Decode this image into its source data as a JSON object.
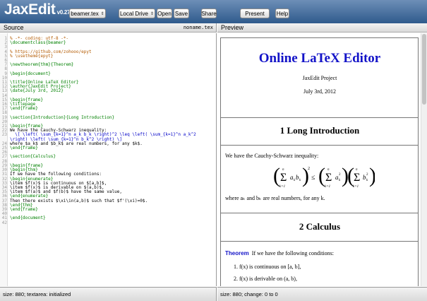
{
  "toolbar": {
    "logo": "JaxEdit",
    "version": "v0.27b",
    "file_select": "beamer.tex",
    "storage_select": "Local Drive",
    "open_label": "Open",
    "save_label": "Save",
    "share_label": "Share",
    "present_label": "Present",
    "help_label": "Help"
  },
  "source": {
    "title": "Source",
    "filename": "noname.tex",
    "lines": [
      {
        "n": "1",
        "text": "% -*- coding: utf-8 -*-",
        "color": "c-orange"
      },
      {
        "n": "2",
        "text": "\\documentclass{beamer}",
        "color": "c-green"
      },
      {
        "n": "3",
        "text": "",
        "color": "c-black"
      },
      {
        "n": "4",
        "text": "% https://github.com/zohooo/epyt",
        "color": "c-orange"
      },
      {
        "n": "5",
        "text": "% \\usetheme{epyt}",
        "color": "c-orange"
      },
      {
        "n": "6",
        "text": "",
        "color": "c-black"
      },
      {
        "n": "7",
        "text": "\\newtheorem{thm}{Theorem}",
        "color": "c-green"
      },
      {
        "n": "8",
        "text": "",
        "color": "c-black"
      },
      {
        "n": "9",
        "text": "\\begin{document}",
        "color": "c-green"
      },
      {
        "n": "10",
        "text": "",
        "color": "c-black"
      },
      {
        "n": "11",
        "text": "\\title{Online LaTeX Editor}",
        "color": "c-green"
      },
      {
        "n": "12",
        "text": "\\author{JaxEdit Project}",
        "color": "c-green"
      },
      {
        "n": "13",
        "text": "\\date{July 3rd, 2012}",
        "color": "c-green"
      },
      {
        "n": "14",
        "text": "",
        "color": "c-black"
      },
      {
        "n": "15",
        "text": "\\begin{frame}",
        "color": "c-green"
      },
      {
        "n": "16",
        "text": "\\titlepage",
        "color": "c-green"
      },
      {
        "n": "17",
        "text": "\\end{frame}",
        "color": "c-green"
      },
      {
        "n": "18",
        "text": "",
        "color": "c-black"
      },
      {
        "n": "19",
        "text": "\\section{Introduction}{Long Introduction}",
        "color": "c-green"
      },
      {
        "n": "20",
        "text": "",
        "color": "c-black"
      },
      {
        "n": "21",
        "text": "\\begin{frame}",
        "color": "c-green"
      },
      {
        "n": "22",
        "text": "We have the Cauchy-Schwarz inequality:",
        "color": "c-black"
      },
      {
        "n": "23",
        "text": "  \\[ \\left( \\sum_{k=1}^n a_k b_k \\right)^2 \\leq \\left( \\sum_{k=1}^n a_k^2",
        "color": "c-blue"
      },
      {
        "n": "",
        "text": "\\right) \\left( \\sum_{k=1}^n b_k^2 \\right) \\]",
        "color": "c-blue"
      },
      {
        "n": "24",
        "text": "where $a_k$ and $b_k$ are real numbers, for any $k$.",
        "color": "c-black"
      },
      {
        "n": "25",
        "text": "\\end{frame}",
        "color": "c-green"
      },
      {
        "n": "26",
        "text": "",
        "color": "c-black"
      },
      {
        "n": "27",
        "text": "\\section{Calculus}",
        "color": "c-green"
      },
      {
        "n": "28",
        "text": "",
        "color": "c-black"
      },
      {
        "n": "29",
        "text": "\\begin{frame}",
        "color": "c-green"
      },
      {
        "n": "30",
        "text": "\\begin{thm}",
        "color": "c-green"
      },
      {
        "n": "31",
        "text": "If we have the following conditions:",
        "color": "c-black"
      },
      {
        "n": "32",
        "text": "\\begin{enumerate}",
        "color": "c-green"
      },
      {
        "n": "33",
        "text": "\\item $f(x)$ is continuous on $[a,b]$,",
        "color": "c-black"
      },
      {
        "n": "34",
        "text": "\\item $f(x)$ is derivable on $(a,b)$,",
        "color": "c-black"
      },
      {
        "n": "35",
        "text": "\\item $f(a)$ and $f(b)$ have the same value,",
        "color": "c-black"
      },
      {
        "n": "36",
        "text": "\\end{enumerate}",
        "color": "c-green"
      },
      {
        "n": "37",
        "text": "Then there exists $\\xi\\in(a,b)$ such that $f'(\\xi)=0$.",
        "color": "c-black"
      },
      {
        "n": "38",
        "text": "\\end{thm}",
        "color": "c-green"
      },
      {
        "n": "39",
        "text": "\\end{frame}",
        "color": "c-green"
      },
      {
        "n": "40",
        "text": "",
        "color": "c-black"
      },
      {
        "n": "41",
        "text": "\\end{document}",
        "color": "c-green"
      },
      {
        "n": "42",
        "text": "",
        "color": "c-black"
      }
    ]
  },
  "preview": {
    "title": "Preview",
    "doc_title": "Online LaTeX Editor",
    "author": "JaxEdit Project",
    "date": "July 3rd, 2012",
    "section1": "1 Long Introduction",
    "cs_intro": "We have the Cauchy-Schwarz inequality:",
    "cs_where": "where aₖ and bₖ are real numbers, for any k.",
    "section2": "2 Calculus",
    "thm_label": "Theorem",
    "thm_text": "If we have the following conditions:",
    "item1": "1.  f(x) is continuous on [a, b],",
    "item2": "2.  f(x) is derivable on (a, b),"
  },
  "status": {
    "left": "size: 880; textarea: initialized",
    "right": "size: 880; change: 0 to 0"
  }
}
